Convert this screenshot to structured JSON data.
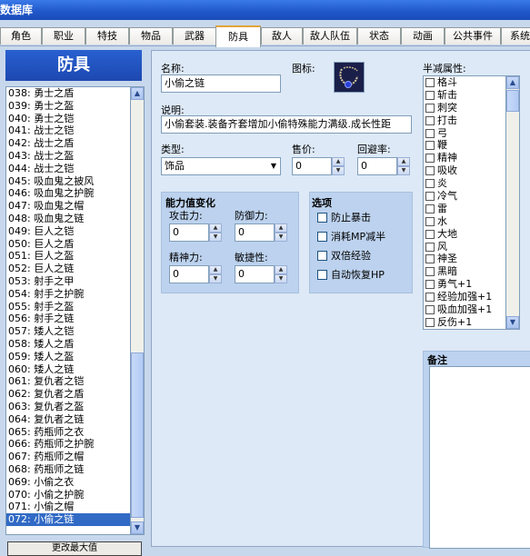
{
  "window": {
    "title": "数据库"
  },
  "tabs": [
    "角色",
    "职业",
    "特技",
    "物品",
    "武器",
    "防具",
    "敌人",
    "敌人队伍",
    "状态",
    "动画",
    "公共事件",
    "系统"
  ],
  "active_tab": "防具",
  "left_panel": {
    "title": "防具",
    "items": [
      "038: 勇士之盾",
      "039: 勇士之盔",
      "040: 勇士之铠",
      "041: 战士之铠",
      "042: 战士之盾",
      "043: 战士之盔",
      "044: 战士之铠",
      "045: 吸血鬼之披风",
      "046: 吸血鬼之护腕",
      "047: 吸血鬼之帽",
      "048: 吸血鬼之链",
      "049: 巨人之铠",
      "050: 巨人之盾",
      "051: 巨人之盔",
      "052: 巨人之链",
      "053: 射手之甲",
      "054: 射手之护腕",
      "055: 射手之盔",
      "056: 射手之链",
      "057: 矮人之铠",
      "058: 矮人之盾",
      "059: 矮人之盔",
      "060: 矮人之链",
      "061: 复仇者之铠",
      "062: 复仇者之盾",
      "063: 复仇者之盔",
      "064: 复仇者之链",
      "065: 药瓶师之衣",
      "066: 药瓶师之护腕",
      "067: 药瓶师之帽",
      "068: 药瓶师之链",
      "069: 小偷之衣",
      "070: 小偷之护腕",
      "071: 小偷之帽",
      "072: 小偷之链"
    ],
    "selected": "072: 小偷之链",
    "bottom_button": "更改最大值"
  },
  "form": {
    "name_label": "名称:",
    "name_value": "小偷之链",
    "icon_label": "图标:",
    "icon_name": "necklace-icon",
    "desc_label": "说明:",
    "desc_value": "小偷套装.装备齐套增加小偷特殊能力满级.成长性距",
    "type_label": "类型:",
    "type_value": "饰品",
    "price_label": "售价:",
    "price_value": "0",
    "evasion_label": "回避率:",
    "evasion_value": "0",
    "stats_title": "能力值变化",
    "atk_label": "攻击力:",
    "atk_value": "0",
    "def_label": "防御力:",
    "def_value": "0",
    "spi_label": "精神力:",
    "spi_value": "0",
    "agi_label": "敏捷性:",
    "agi_value": "0",
    "options_title": "选项",
    "options": [
      "防止暴击",
      "消耗MP减半",
      "双倍经验",
      "自动恢复HP"
    ],
    "resist_label": "半减属性:",
    "resist_items": [
      "格斗",
      "斩击",
      "刺突",
      "打击",
      "弓",
      "鞭",
      "精神",
      "吸收",
      "炎",
      "冷气",
      "雷",
      "水",
      "大地",
      "风",
      "神圣",
      "黑暗",
      "勇气+1",
      "经验加强+1",
      "吸血加强+1",
      "反伤+1"
    ],
    "notes_label": "备注"
  },
  "colors": {
    "selection": "#316ac5",
    "header": "#2860d0",
    "panel": "#dde9f6",
    "group": "#bcd2ee",
    "tab_accent": "#e5a33a"
  }
}
